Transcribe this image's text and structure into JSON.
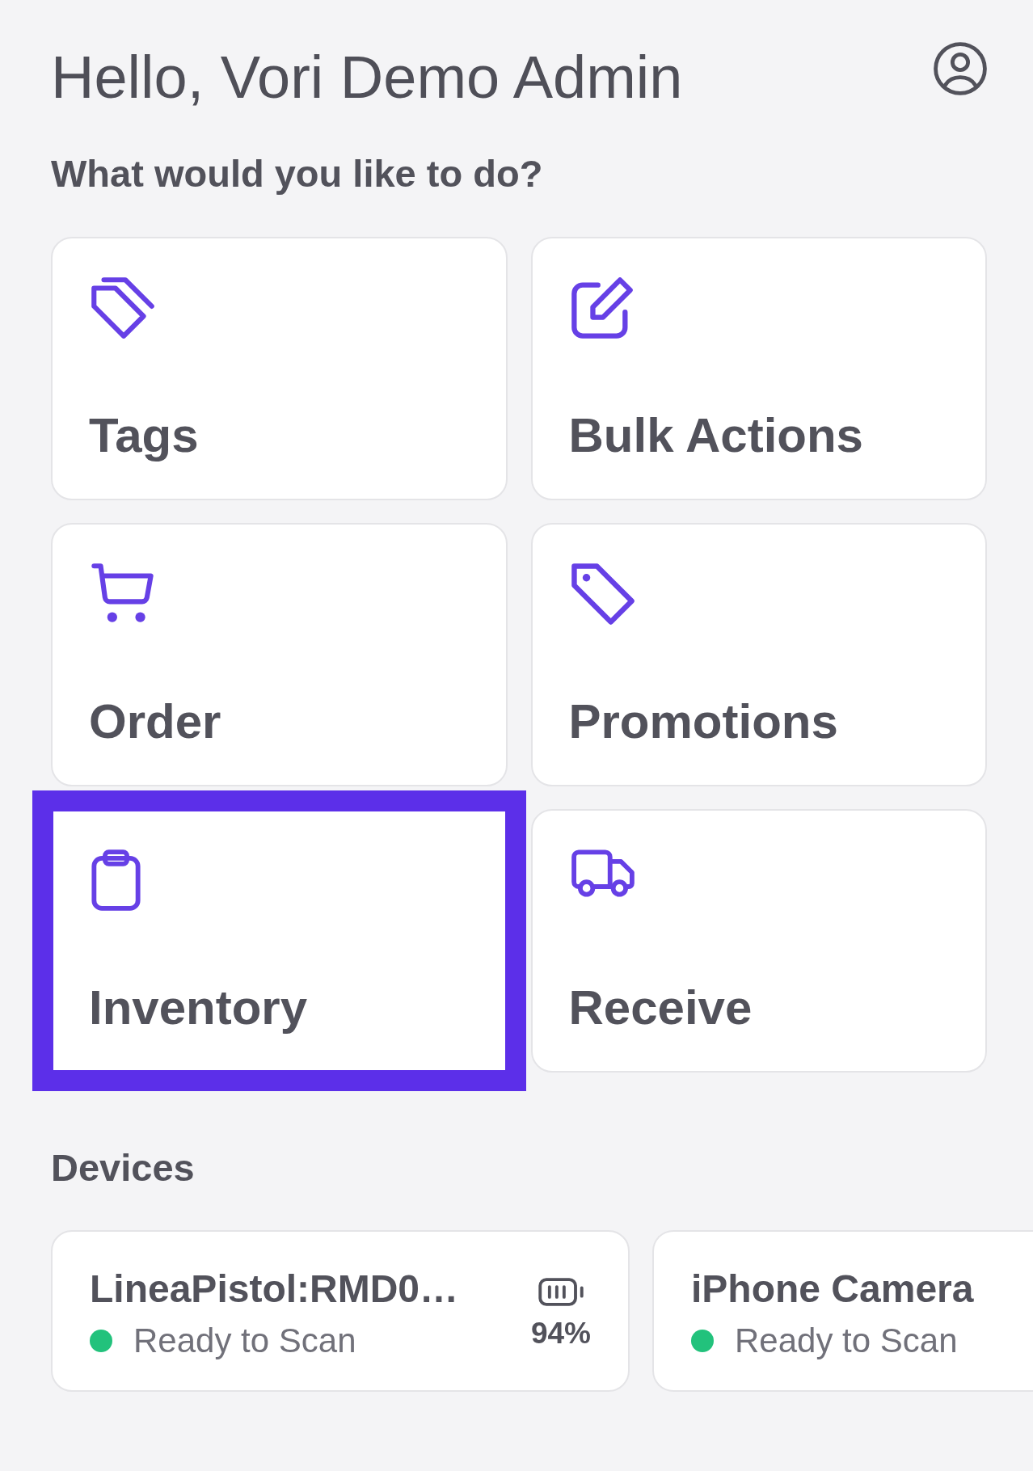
{
  "greeting": "Hello, Vori Demo Admin",
  "prompt": "What would you like to do?",
  "actions": [
    {
      "label": "Tags",
      "selected": false
    },
    {
      "label": "Bulk Actions",
      "selected": false
    },
    {
      "label": "Order",
      "selected": false
    },
    {
      "label": "Promotions",
      "selected": false
    },
    {
      "label": "Inventory",
      "selected": true
    },
    {
      "label": "Receive",
      "selected": false
    }
  ],
  "devices_heading": "Devices",
  "devices": [
    {
      "name": "LineaPistol:RMD0…",
      "status": "Ready to Scan",
      "color": "#22c27c",
      "battery": "94%"
    },
    {
      "name": "iPhone Camera",
      "status": "Ready to Scan",
      "color": "#22c27c"
    }
  ]
}
